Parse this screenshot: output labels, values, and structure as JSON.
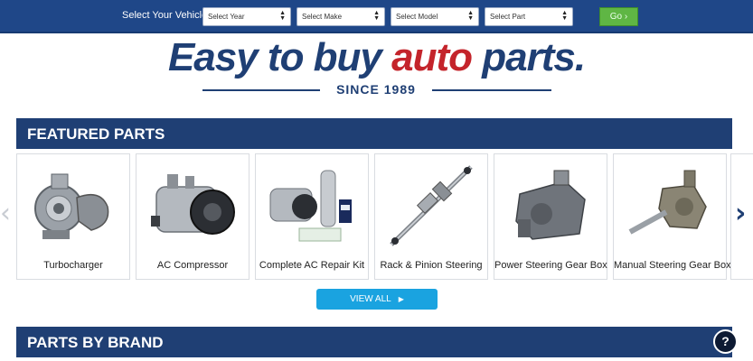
{
  "vehicle_selector": {
    "label": "Select Your Vehicle",
    "year_placeholder": "Select Year",
    "make_placeholder": "Select Make",
    "model_placeholder": "Select Model",
    "part_placeholder": "Select Part",
    "go_label": "Go ›"
  },
  "hero": {
    "title_part1": "Easy to buy ",
    "title_accent": "auto",
    "title_part2": " parts.",
    "since": "SINCE 1989"
  },
  "featured": {
    "title": "FEATURED PARTS",
    "items": [
      {
        "name": "Turbocharger",
        "icon": "turbocharger-image"
      },
      {
        "name": "AC Compressor",
        "icon": "ac-compressor-image"
      },
      {
        "name": "Complete AC Repair Kit",
        "icon": "ac-repair-kit-image"
      },
      {
        "name": "Rack & Pinion Steering",
        "icon": "rack-pinion-image"
      },
      {
        "name": "Power Steering Gear Box",
        "icon": "power-steering-gearbox-image"
      },
      {
        "name": "Manual Steering Gear Box",
        "icon": "manual-steering-gearbox-image"
      }
    ],
    "view_all_label": "VIEW ALL",
    "prev_icon": "‹",
    "next_icon": "›"
  },
  "brands": {
    "title": "PARTS BY BRAND"
  },
  "help_label": "?",
  "colors": {
    "topbar": "#1f4788",
    "navy": "#1f3f74",
    "accent_red": "#c4242b",
    "go_green": "#5fb644",
    "view_all_blue": "#1aa3e0"
  }
}
